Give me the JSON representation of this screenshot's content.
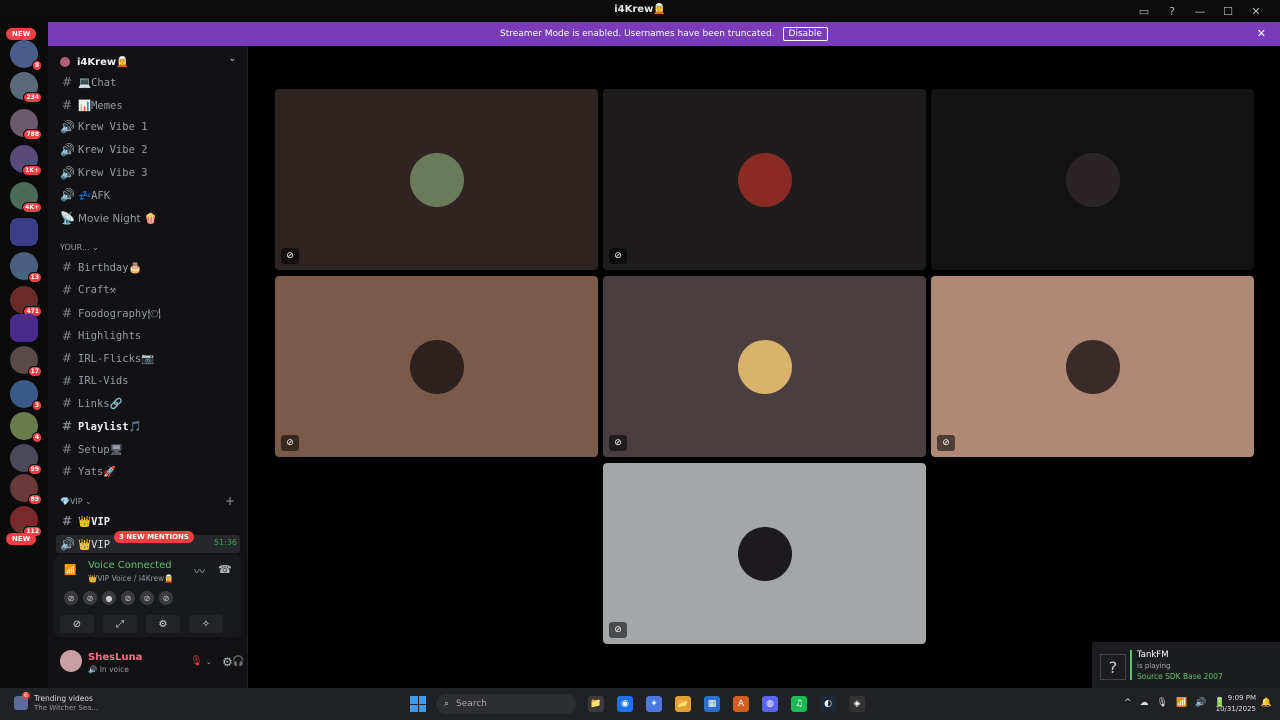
{
  "window": {
    "title": "i4Krew🧝",
    "controls": [
      "inbox-icon",
      "help-icon",
      "minimize-icon",
      "maximize-icon",
      "close-icon"
    ]
  },
  "banner": {
    "text": "Streamer Mode is enabled. Usernames have been truncated.",
    "button": "Disable",
    "close": "✕",
    "color": "#7a3bb9"
  },
  "server_rail": {
    "new_top": "NEW",
    "new_bottom": "NEW",
    "badges": [
      "8",
      "234",
      "788",
      "1K+",
      "4K+",
      "13",
      "471",
      "17",
      "3",
      "4",
      "99",
      "89",
      "112"
    ]
  },
  "guild": {
    "name": "i4Krew🧝",
    "chevron": "⌄"
  },
  "channels": [
    {
      "symbol": "#",
      "label": "💻Chat"
    },
    {
      "symbol": "#",
      "label": "📊Memes"
    },
    {
      "symbol": "🔊",
      "label": "Krew Vibe 1"
    },
    {
      "symbol": "🔊",
      "label": "Krew Vibe 2"
    },
    {
      "symbol": "🔊",
      "label": "Krew Vibe 3"
    },
    {
      "symbol": "🔊",
      "label": "💤AFK"
    },
    {
      "symbol": "📡",
      "label": "Movie Night 🍿"
    }
  ],
  "category_your": "YOUR... ⌄",
  "your_channels": [
    {
      "symbol": "#",
      "label": "Birthday🎂"
    },
    {
      "symbol": "#",
      "label": "Craft⚒"
    },
    {
      "symbol": "#",
      "label": "Foodography🍽"
    },
    {
      "symbol": "#",
      "label": "Highlights"
    },
    {
      "symbol": "#",
      "label": "IRL-Flicks📷"
    },
    {
      "symbol": "#",
      "label": "IRL-Vids"
    },
    {
      "symbol": "#",
      "label": "Links🔗"
    },
    {
      "symbol": "#",
      "label": "Playlist🎵"
    },
    {
      "symbol": "#",
      "label": "Setup🖥"
    },
    {
      "symbol": "#",
      "label": "Yats🚀"
    }
  ],
  "category_vip": "💎VIP ⌄",
  "category_vip_plus": "+",
  "vip_channels": [
    {
      "symbol": "#",
      "label": "👑VIP"
    },
    {
      "symbol": "🔊",
      "label": "👑VIP"
    }
  ],
  "mentions_pill": "3 NEW MENTIONS",
  "voice_timer": "51:36",
  "voice": {
    "title": "Voice Connected",
    "subtitle": "👑VIP Voice / i4Krew🧝",
    "signal": "📶",
    "wave": "〰",
    "hangup": "☎",
    "participants": [
      "⊘",
      "⊘",
      "●",
      "⊘",
      "⊘",
      "⊘"
    ],
    "buttons": [
      "⊘",
      "⤢",
      "⚙",
      "✧"
    ]
  },
  "user": {
    "name": "ShesLuna",
    "status": "🔊 In voice",
    "mic": "🎙",
    "headset": "🎧",
    "settings": "⚙"
  },
  "tiles": [
    {
      "bg": "#2e2422",
      "avatar": "#6b7a5a",
      "mute": "⊘"
    },
    {
      "bg": "#1e1c1c",
      "avatar": "#8a2a24",
      "mute": "⊘"
    },
    {
      "bg": "#141313",
      "avatar": "#2a2426",
      "mute": ""
    },
    {
      "bg": "#7a5a48",
      "avatar": "#2e2220",
      "mute": "⊘"
    },
    {
      "bg": "#4a3e40",
      "avatar": "#d9b36a",
      "mute": "⊘"
    },
    {
      "bg": "#b08876",
      "avatar": "#3a2a28",
      "mute": "⊘"
    },
    {
      "bg": "#a3a7a8",
      "avatar": "#1c1a1c",
      "mute": "⊘"
    }
  ],
  "toast": {
    "icon": "?",
    "name": "TankFM",
    "line2": "is playing",
    "game": "Source SDK Base 2007"
  },
  "taskbar": {
    "news_title": "Trending videos",
    "news_sub": "The Witcher Sea...",
    "news_badge": "6",
    "search_placeholder": "Search",
    "search_icon": "⌕",
    "time": "9:09 PM",
    "date": "10/31/2025",
    "tray": [
      "^",
      "☁",
      "🎙",
      "📶",
      "🔊",
      "🔋"
    ],
    "bell": "🔔",
    "apps": [
      {
        "icon": "📁",
        "color": "#3a3a3a"
      },
      {
        "icon": "◉",
        "color": "#1a73e8"
      },
      {
        "icon": "✦",
        "color": "#4a7ae0"
      },
      {
        "icon": "📂",
        "color": "#e0a030"
      },
      {
        "icon": "▦",
        "color": "#2a6fd0"
      },
      {
        "icon": "A",
        "color": "#d06020"
      },
      {
        "icon": "◍",
        "color": "#5865f2"
      },
      {
        "icon": "♫",
        "color": "#1db954"
      },
      {
        "icon": "◐",
        "color": "#1b2838"
      },
      {
        "icon": "◈",
        "color": "#333333"
      }
    ]
  }
}
